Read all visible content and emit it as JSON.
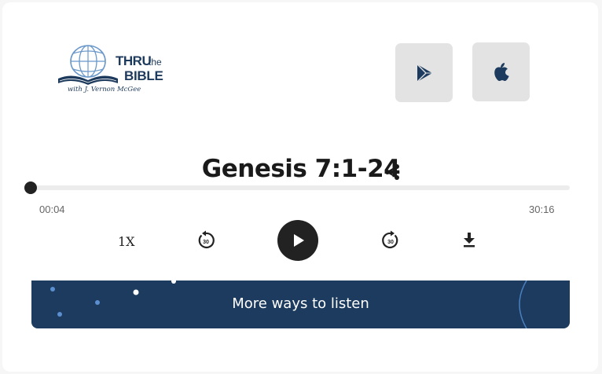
{
  "logo": {
    "line1": "THRU",
    "line1_small": "the",
    "line2": "BIBLE",
    "tagline": "with J. Vernon McGee"
  },
  "store_buttons": [
    {
      "icon": "google-play-icon"
    },
    {
      "icon": "apple-icon"
    }
  ],
  "episode": {
    "title": "Genesis 7:1-24"
  },
  "player": {
    "elapsed": "00:04",
    "duration": "30:16",
    "progress_fraction": 0.002,
    "speed": "1X",
    "rewind_icon": "rewind-30-icon",
    "forward_icon": "forward-30-icon",
    "play_icon": "play-icon",
    "download_icon": "download-icon"
  },
  "more_ways": {
    "label": "More ways to listen"
  },
  "colors": {
    "brand_navy": "#1c3b5e",
    "logo_blue": "#1d3a5c",
    "button_gray": "#e3e3e3",
    "dark": "#222222"
  }
}
